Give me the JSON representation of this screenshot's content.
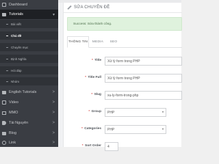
{
  "sidebar": {
    "items": [
      {
        "label": "Dashboard",
        "icon": "dashboard-icon"
      },
      {
        "label": "Tutorials",
        "icon": "folder-icon"
      },
      {
        "label": "English Tutorials",
        "icon": "folder-icon"
      },
      {
        "label": "Video",
        "icon": "video-icon"
      },
      {
        "label": "MMO",
        "icon": "monitor-icon"
      },
      {
        "label": "Tài Nguyên",
        "icon": "tag-icon"
      },
      {
        "label": "Blog",
        "icon": "folder-icon"
      },
      {
        "label": "Link",
        "icon": "link-icon"
      }
    ],
    "sub_items": [
      {
        "label": "Bài viết"
      },
      {
        "label": "Chủ đề"
      },
      {
        "label": "Chuyên mục"
      },
      {
        "label": "Định Nghĩa"
      },
      {
        "label": "Hỏi đáp"
      },
      {
        "label": "Nhóm"
      }
    ],
    "chevron": ">"
  },
  "header": {
    "title": "SỬA CHUYÊN ĐỀ"
  },
  "alert": {
    "text": "Success: Sửa thành công."
  },
  "tabs": [
    {
      "label": "THÔNG TIN"
    },
    {
      "label": "MEDIA"
    },
    {
      "label": "SEO"
    }
  ],
  "form": {
    "required_mark": "*",
    "title": {
      "label": "Title",
      "value": "Xử lý form trong PHP"
    },
    "title_full": {
      "label": "Title Full",
      "value": "Xử lý form trong PHP"
    },
    "slug": {
      "label": "Slug",
      "value": "xu-ly-form-trong-php"
    },
    "group": {
      "label": "Group",
      "value": "PHP"
    },
    "categories": {
      "label": "Categories",
      "value": "PHP"
    },
    "sort_order": {
      "label": "Sort Order",
      "value": "4"
    }
  },
  "colors": {
    "sidebar_bg": "#3a3d43",
    "active_bg": "#1e2024",
    "alert_bg": "#dff2dd",
    "required": "#d9534f"
  }
}
